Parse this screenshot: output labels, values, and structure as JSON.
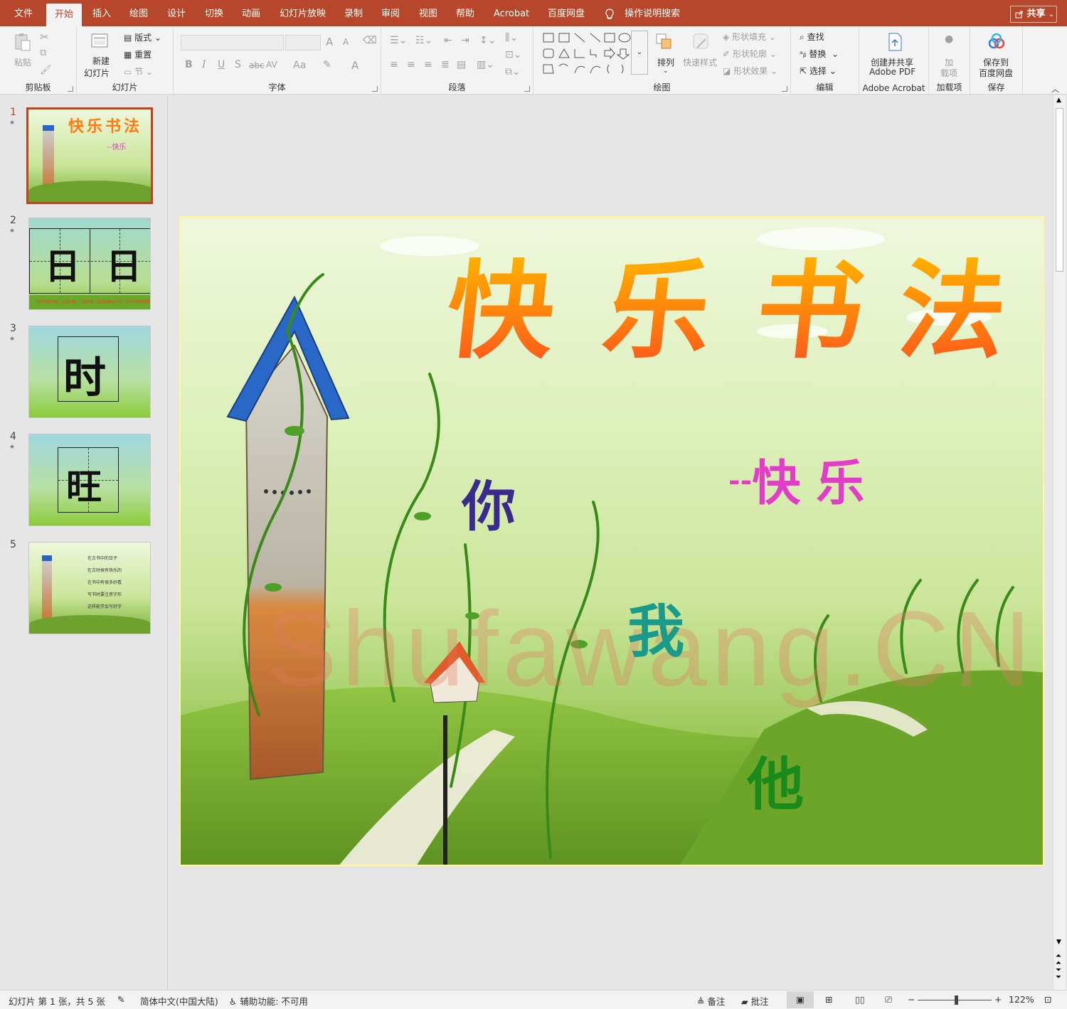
{
  "menubar": {
    "tabs": [
      "文件",
      "开始",
      "插入",
      "绘图",
      "设计",
      "切换",
      "动画",
      "幻灯片放映",
      "录制",
      "审阅",
      "视图",
      "帮助",
      "Acrobat",
      "百度网盘"
    ],
    "active_tab": "开始",
    "tell_me": "操作说明搜索",
    "share": "共享"
  },
  "ribbon": {
    "clipboard": {
      "label": "剪贴板",
      "paste": "粘贴"
    },
    "slides": {
      "label": "幻灯片",
      "new_slide": "新建幻灯片",
      "new_line1": "新建",
      "new_line2": "幻灯片",
      "layout": "版式",
      "reset": "重置",
      "section": "节"
    },
    "font": {
      "label": "字体",
      "bold": "B",
      "italic": "I",
      "underline": "U",
      "shadow": "S",
      "strike": "abc",
      "spacing": "AV",
      "case": "Aa",
      "grow": "A",
      "shrink": "A"
    },
    "paragraph": {
      "label": "段落"
    },
    "drawing": {
      "label": "绘图",
      "arrange": "排列",
      "quick_styles": "快速样式",
      "shape_fill": "形状填充",
      "shape_outline": "形状轮廓",
      "shape_effects": "形状效果"
    },
    "editing": {
      "label": "编辑",
      "find": "查找",
      "replace": "替换",
      "select": "选择"
    },
    "acrobat": {
      "label": "Adobe Acrobat",
      "create_line1": "创建并共享",
      "create_line2": "Adobe PDF"
    },
    "addins": {
      "label": "加载项",
      "btn_line1": "加",
      "btn_line2": "载项"
    },
    "save": {
      "label": "保存",
      "btn_line1": "保存到",
      "btn_line2": "百度网盘"
    }
  },
  "thumbnails": [
    {
      "num": "1",
      "title": "快乐书法",
      "sub": "--快乐"
    },
    {
      "num": "2",
      "chars": [
        "日",
        "日"
      ],
      "caption": "日字写的时候：上边的宽，下边的窄，里边的横在中间，写日字的时候要注意。"
    },
    {
      "num": "3",
      "char": "时"
    },
    {
      "num": "4",
      "char": "旺"
    },
    {
      "num": "5",
      "lines": [
        "在古书中的日子",
        "在古时候有快乐的",
        "在书中有很多好看",
        "写书时要注意字形",
        "这样能学会写好字"
      ]
    }
  ],
  "slide": {
    "title_chars": [
      "快",
      "乐",
      "书",
      "法"
    ],
    "subtitle": "--快乐",
    "subtitle_dash": "--",
    "subtitle_chars": [
      "快",
      "乐"
    ],
    "ni": "你",
    "wo": "我",
    "ta": "他",
    "watermark": "Shufawang.CN"
  },
  "status": {
    "slide_info": "幻灯片 第 1 张，共 5 张",
    "language": "简体中文(中国大陆)",
    "accessibility": "辅助功能: 不可用",
    "notes": "备注",
    "comments": "批注",
    "zoom": "122%"
  },
  "colors": {
    "accent": "#b7472a",
    "title_top": "#ffb000",
    "title_bottom": "#ff5a1a",
    "subtitle": "#e23cc8",
    "ni": "#3a2a8c",
    "wo": "#1a9a8a",
    "ta": "#1a8a1a"
  }
}
